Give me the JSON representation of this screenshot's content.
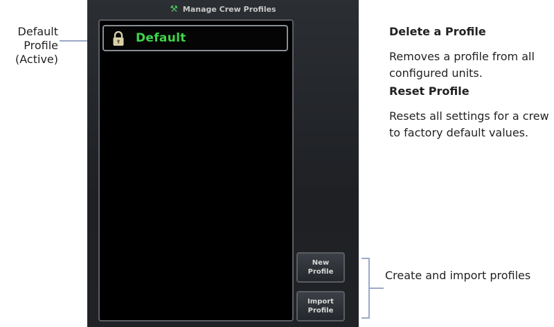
{
  "callouts": {
    "default_profile_line1": "Default",
    "default_profile_line2": "Profile",
    "default_profile_line3": "(Active)",
    "create_import": "Create and import profiles"
  },
  "screen": {
    "title": "Manage Crew Profiles",
    "title_icon": "tools-icon",
    "profiles": [
      {
        "name": "Default",
        "state": "active",
        "icon": "lock-icon"
      }
    ],
    "buttons": {
      "new_line1": "New",
      "new_line2": "Profile",
      "import_line1": "Import",
      "import_line2": "Profile"
    }
  },
  "info": {
    "delete_heading": "Delete a Profile",
    "delete_text": "Removes a profile from all configured units.",
    "reset_heading": "Reset Profile",
    "reset_text": "Resets all settings for a crew to factory default values."
  },
  "colors": {
    "profile_active_text": "#3fd44a",
    "screen_bg": "#000000",
    "callout_line": "#9aa9c8"
  }
}
